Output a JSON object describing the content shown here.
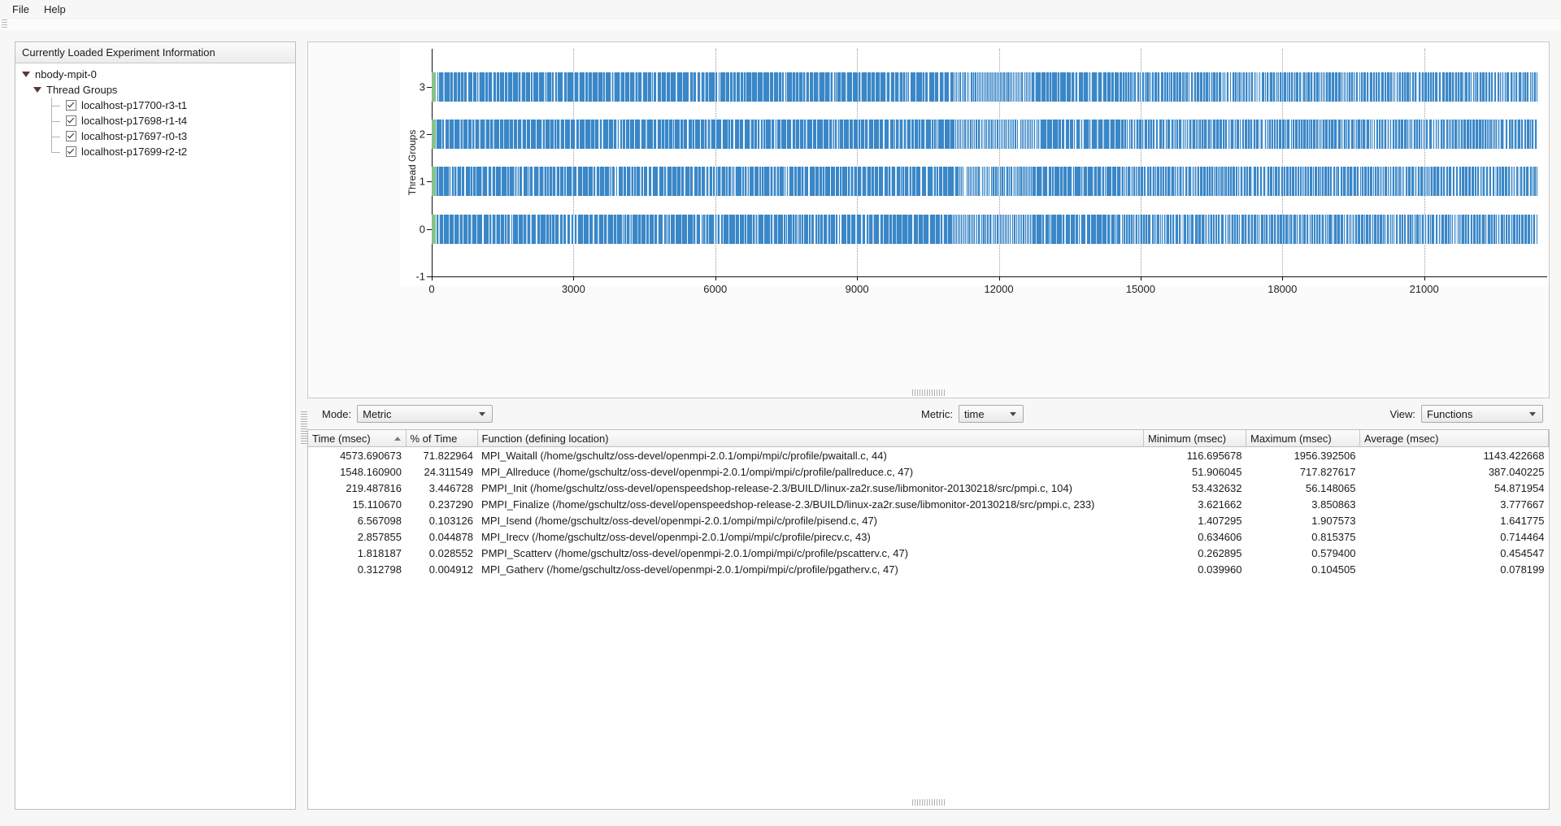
{
  "menubar": {
    "items": [
      "File",
      "Help"
    ]
  },
  "left_panel": {
    "header": "Currently Loaded Experiment Information",
    "tree": {
      "root": "nbody-mpit-0",
      "group": "Thread Groups",
      "threads": [
        "localhost-p17700-r3-t1",
        "localhost-p17698-r1-t4",
        "localhost-p17697-r0-t3",
        "localhost-p17699-r2-t2"
      ]
    }
  },
  "controls": {
    "mode_label": "Mode:",
    "mode_value": "Metric",
    "metric_label": "Metric:",
    "metric_value": "time",
    "view_label": "View:",
    "view_value": "Functions"
  },
  "chart_data": {
    "type": "bar",
    "title": "",
    "xlabel": "",
    "ylabel": "Thread Groups",
    "categories": [
      "0",
      "1",
      "2",
      "3"
    ],
    "yticks": [
      "-1",
      "0",
      "1",
      "2",
      "3"
    ],
    "xticks": [
      0,
      3000,
      6000,
      9000,
      12000,
      15000,
      18000,
      21000
    ],
    "xlim": [
      0,
      23500
    ],
    "ylim": [
      -1,
      3.8
    ],
    "grid": "vertical-dotted",
    "legend": "none",
    "series": [
      {
        "name": "Thread Group 3",
        "y": 3,
        "start": 0,
        "end": 23400,
        "lead_color": "#86c28c",
        "color": "#3a87c8"
      },
      {
        "name": "Thread Group 2",
        "y": 2,
        "start": 0,
        "end": 23400,
        "lead_color": "#86c28c",
        "color": "#3a87c8"
      },
      {
        "name": "Thread Group 1",
        "y": 1,
        "start": 0,
        "end": 23400,
        "lead_color": "#86c28c",
        "color": "#3a87c8"
      },
      {
        "name": "Thread Group 0",
        "y": 0,
        "start": 0,
        "end": 23400,
        "lead_color": "#86c28c",
        "color": "#3a87c8"
      }
    ]
  },
  "table": {
    "columns": [
      "Time (msec)",
      "% of Time",
      "Function (defining location)",
      "Minimum (msec)",
      "Maximum (msec)",
      "Average (msec)"
    ],
    "sorted_column": 0,
    "rows": [
      {
        "time": "4573.690673",
        "pct": "71.822964",
        "fn": "MPI_Waitall (/home/gschultz/oss-devel/openmpi-2.0.1/ompi/mpi/c/profile/pwaitall.c, 44)",
        "min": "116.695678",
        "max": "1956.392506",
        "avg": "1143.422668"
      },
      {
        "time": "1548.160900",
        "pct": "24.311549",
        "fn": "MPI_Allreduce (/home/gschultz/oss-devel/openmpi-2.0.1/ompi/mpi/c/profile/pallreduce.c, 47)",
        "min": "51.906045",
        "max": "717.827617",
        "avg": "387.040225"
      },
      {
        "time": "219.487816",
        "pct": "3.446728",
        "fn": "PMPI_Init (/home/gschultz/oss-devel/openspeedshop-release-2.3/BUILD/linux-za2r.suse/libmonitor-20130218/src/pmpi.c, 104)",
        "min": "53.432632",
        "max": "56.148065",
        "avg": "54.871954"
      },
      {
        "time": "15.110670",
        "pct": "0.237290",
        "fn": "PMPI_Finalize (/home/gschultz/oss-devel/openspeedshop-release-2.3/BUILD/linux-za2r.suse/libmonitor-20130218/src/pmpi.c, 233)",
        "min": "3.621662",
        "max": "3.850863",
        "avg": "3.777667"
      },
      {
        "time": "6.567098",
        "pct": "0.103126",
        "fn": "MPI_Isend (/home/gschultz/oss-devel/openmpi-2.0.1/ompi/mpi/c/profile/pisend.c, 47)",
        "min": "1.407295",
        "max": "1.907573",
        "avg": "1.641775"
      },
      {
        "time": "2.857855",
        "pct": "0.044878",
        "fn": "MPI_Irecv (/home/gschultz/oss-devel/openmpi-2.0.1/ompi/mpi/c/profile/pirecv.c, 43)",
        "min": "0.634606",
        "max": "0.815375",
        "avg": "0.714464"
      },
      {
        "time": "1.818187",
        "pct": "0.028552",
        "fn": "PMPI_Scatterv (/home/gschultz/oss-devel/openmpi-2.0.1/ompi/mpi/c/profile/pscatterv.c, 47)",
        "min": "0.262895",
        "max": "0.579400",
        "avg": "0.454547"
      },
      {
        "time": "0.312798",
        "pct": "0.004912",
        "fn": "MPI_Gatherv (/home/gschultz/oss-devel/openmpi-2.0.1/ompi/mpi/c/profile/pgatherv.c, 47)",
        "min": "0.039960",
        "max": "0.104505",
        "avg": "0.078199"
      }
    ]
  }
}
